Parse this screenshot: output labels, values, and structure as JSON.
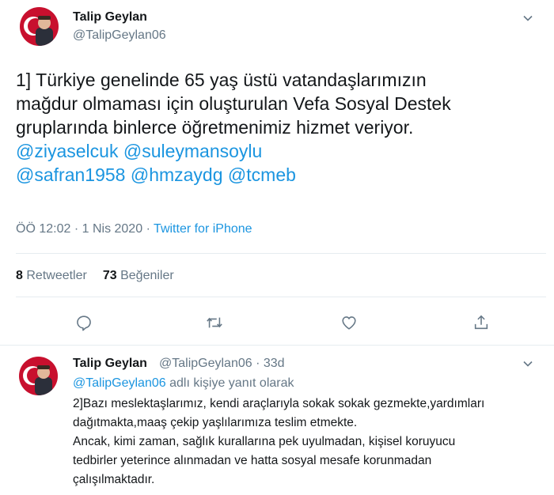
{
  "main_tweet": {
    "author_name": "Talip Geylan",
    "author_handle": "@TalipGeylan06",
    "text_lines": [
      "1] Türkiye genelinde 65 yaş üstü vatandaşlarımızın",
      "mağdur olmaması için oluşturulan Vefa Sosyal Destek",
      "gruplarında binlerce öğretmenimiz hizmet veriyor."
    ],
    "mentions_line1": [
      "@ziyaselcuk",
      "@suleymansoylu"
    ],
    "mentions_line2": [
      "@safran1958",
      "@hmzaydg",
      "@tcmeb"
    ],
    "time": "ÖÖ 12:02",
    "date": "1 Nis 2020",
    "separator": "·",
    "source": "Twitter for iPhone",
    "retweet_count": "8",
    "retweet_label": "Retweetler",
    "like_count": "73",
    "like_label": "Beğeniler"
  },
  "actions": {
    "reply_icon": "reply-icon",
    "retweet_icon": "retweet-icon",
    "like_icon": "heart-icon",
    "share_icon": "share-icon"
  },
  "reply_tweet": {
    "author_name": "Talip Geylan",
    "author_handle": "@TalipGeylan06",
    "separator": "·",
    "age": "33d",
    "reply_to_mention": "@TalipGeylan06",
    "reply_to_suffix": "adlı kişiye yanıt olarak",
    "text_lines": [
      "2]Bazı meslektaşlarımız, kendi araçlarıyla sokak sokak gezmekte,yardımları",
      "dağıtmakta,maaş çekip yaşlılarımıza teslim etmekte.",
      "Ancak, kimi zaman, sağlık kurallarına pek uyulmadan, kişisel koruyucu",
      "tedbirler yeterince alınmadan ve hatta sosyal mesafe korunmadan",
      "çalışılmaktadır."
    ]
  },
  "colors": {
    "link": "#1b95e0",
    "secondary_text": "#657786",
    "primary_text": "#14171a",
    "divider": "#e6ecf0"
  }
}
